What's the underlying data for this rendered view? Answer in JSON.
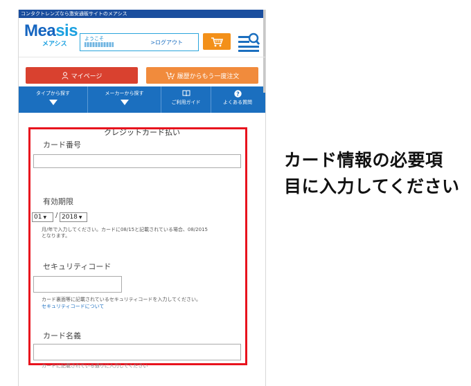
{
  "site": {
    "topbar_text": "コンタクトレンズなら激安通販サイトのメアシス",
    "logo_main": "Mea",
    "logo_main_tail": "sis",
    "logo_sub": "メアシス",
    "welcome_label": "ようこそ",
    "logout_label": ">ログアウト"
  },
  "actions": {
    "mypage_label": "マイページ",
    "reorder_label": "履歴からもう一度注文"
  },
  "nav": {
    "items": [
      {
        "label": "タイプから探す"
      },
      {
        "label": "メーカーから探す"
      },
      {
        "label": "ご利用ガイド"
      },
      {
        "label": "よくある質問"
      }
    ]
  },
  "page": {
    "title": "クレジットカード払い"
  },
  "form": {
    "card_number_label": "カード番号",
    "card_number_value": "",
    "expiry_label": "有効期限",
    "expiry_month": "01",
    "expiry_year": "2018",
    "expiry_separator": "/",
    "expiry_note_1": "月/年で入力してください。カードに08/15と記載されている場合、08/2015",
    "expiry_note_2": "となります。",
    "security_label": "セキュリティコード",
    "security_value": "",
    "security_note": "カード裏面等に記載されているセキュリティコードを入力してください。",
    "security_link": "セキュリティコードについて",
    "holder_label": "カード名義",
    "holder_value": "",
    "holder_note": "カードに記載されている通りに入力してください"
  },
  "annotation": {
    "line1": "カード情報の必要項",
    "line2": "目に入力してください"
  },
  "colors": {
    "accent_blue": "#1b6fbf",
    "highlight_red": "#e8121d",
    "mypage_red": "#d9412f",
    "reorder_orange": "#f18b3c",
    "cart_orange": "#f39019"
  }
}
